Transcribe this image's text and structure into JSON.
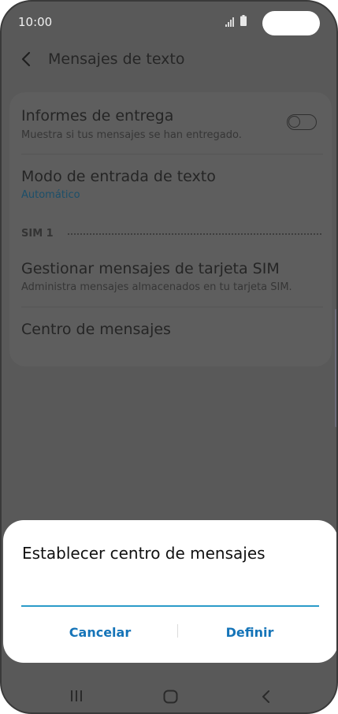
{
  "status_bar": {
    "time": "10:00",
    "icons": [
      "signal-icon",
      "battery-icon"
    ]
  },
  "header": {
    "back_icon": "chevron-left-icon",
    "title": "Mensajes de texto"
  },
  "settings": {
    "delivery_reports": {
      "title": "Informes de entrega",
      "subtitle": "Muestra si tus mensajes se han entregado.",
      "toggle_on": false
    },
    "input_mode": {
      "title": "Modo de entrada de texto",
      "value": "Automático"
    },
    "section_label": "SIM 1",
    "manage_sim": {
      "title": "Gestionar mensajes de tarjeta SIM",
      "subtitle": "Administra mensajes almacenados en tu tarjeta SIM."
    },
    "message_center": {
      "title": "Centro de mensajes"
    }
  },
  "dialog": {
    "title": "Establecer centro de mensajes",
    "input_value": "",
    "cancel_label": "Cancelar",
    "define_label": "Definir"
  },
  "nav_bar": {
    "icons": [
      "recents-icon",
      "home-icon",
      "back-icon"
    ]
  },
  "colors": {
    "accent": "#1574b8",
    "input_underline": "#2b9bc9",
    "scrim_background": "#595959",
    "dialog_background": "#ffffff"
  }
}
